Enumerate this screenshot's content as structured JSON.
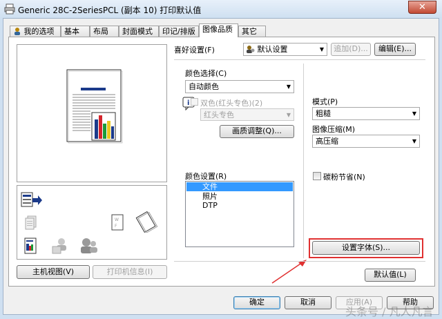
{
  "window": {
    "title": "Generic 28C-2SeriesPCL (副本 10) 打印默认值",
    "close_glyph": "✕"
  },
  "tabs": [
    {
      "label": "我的选项",
      "active": false
    },
    {
      "label": "基本",
      "active": false
    },
    {
      "label": "布局",
      "active": false
    },
    {
      "label": "封面模式",
      "active": false
    },
    {
      "label": "印记/排版",
      "active": false
    },
    {
      "label": "图像品质",
      "active": true
    },
    {
      "label": "其它",
      "active": false
    }
  ],
  "preview": {
    "bars": [
      "#1b3a8a",
      "#d4242c",
      "#1a9a3a",
      "#e8c81e",
      "#1b3a8a"
    ]
  },
  "favorites": {
    "label": "喜好设置(F)",
    "selected": "默认设置",
    "add_label": "追加(D)...",
    "edit_label": "编辑(E)..."
  },
  "color_select": {
    "label": "颜色选择(C)",
    "value": "自动颜色"
  },
  "dual_color": {
    "label": "双色(红头专色)(2)",
    "value": "红头专色"
  },
  "quality_adjust_label": "画质调整(Q)...",
  "color_settings": {
    "label": "颜色设置(R)",
    "items": [
      "文件",
      "照片",
      "DTP"
    ],
    "selected_index": 0
  },
  "pattern": {
    "label": "模式(P)",
    "value": "粗糙"
  },
  "compression": {
    "label": "图像压缩(M)",
    "value": "高压缩"
  },
  "toner_save": {
    "label": "碳粉节省(N)",
    "checked": false
  },
  "set_font_label": "设置字体(S)...",
  "default_values_label": "默认值(L)",
  "host_view_label": "主机视图(V)",
  "printer_info_label": "打印机信息(I)",
  "ok_label": "确定",
  "cancel_label": "取消",
  "apply_label": "应用(A)",
  "help_label": "帮助",
  "watermark": "头条号 / 凡人凡言"
}
